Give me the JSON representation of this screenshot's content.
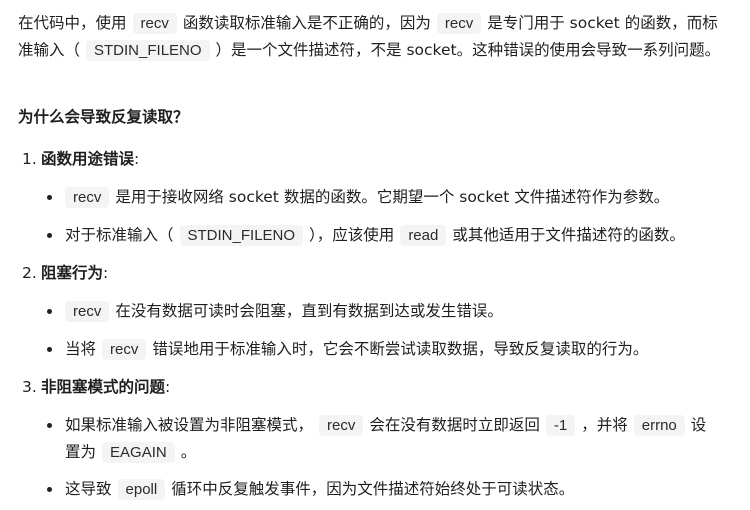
{
  "intro": {
    "t1": "在代码中，使用",
    "c1": "recv",
    "t2": "函数读取标准输入是不正确的，因为",
    "c2": "recv",
    "t3": "是专门用于 socket 的函数，而标准输入（",
    "c3": "STDIN_FILENO",
    "t4": "）是一个文件描述符，不是 socket。这种错误的使用会导致一系列问题。"
  },
  "heading": "为什么会导致反复读取？",
  "items": [
    {
      "num": "1.",
      "title": "函数用途错误",
      "colon": ":",
      "bullets": [
        {
          "c1": "recv",
          "t1": "是用于接收网络 socket 数据的函数。它期望一个 socket 文件描述符作为参数。"
        },
        {
          "t0": "对于标准输入（",
          "c1": "STDIN_FILENO",
          "t1": "），应该使用",
          "c2": "read",
          "t2": "或其他适用于文件描述符的函数。"
        }
      ]
    },
    {
      "num": "2.",
      "title": "阻塞行为",
      "colon": ":",
      "bullets": [
        {
          "c1": "recv",
          "t1": "在没有数据可读时会阻塞，直到有数据到达或发生错误。"
        },
        {
          "t0": "当将",
          "c1": "recv",
          "t1": "错误地用于标准输入时，它会不断尝试读取数据，导致反复读取的行为。"
        }
      ]
    },
    {
      "num": "3.",
      "title": "非阻塞模式的问题",
      "colon": ":",
      "bullets": [
        {
          "t0": "如果标准输入被设置为非阻塞模式，",
          "c1": "recv",
          "t1": "会在没有数据时立即返回",
          "c2": "-1",
          "t2": "，并将",
          "c3": "errno",
          "t3": "设置为",
          "c4": "EAGAIN",
          "t4": "。"
        },
        {
          "t0": "这导致",
          "c1": "epoll",
          "t1": "循环中反复触发事件，因为文件描述符始终处于可读状态。"
        }
      ]
    }
  ]
}
